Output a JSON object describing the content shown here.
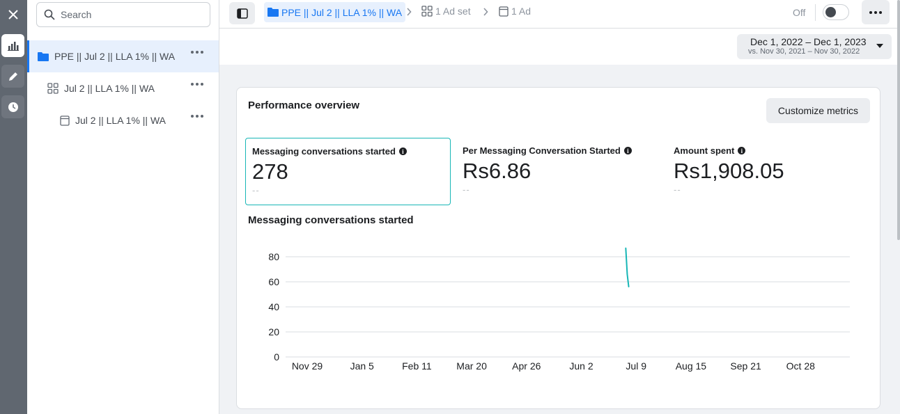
{
  "rail": {
    "close_icon": "close-icon",
    "performance_icon": "bar-chart-icon",
    "edit_icon": "pencil-icon",
    "history_icon": "clock-icon"
  },
  "sidebar": {
    "search_placeholder": "Search",
    "items": [
      {
        "label": "PPE || Jul 2 || LLA 1% || WA",
        "level": "campaign",
        "icon": "folder-icon"
      },
      {
        "label": "Jul 2 || LLA 1% || WA",
        "level": "ad-set",
        "icon": "grid-icon"
      },
      {
        "label": "Jul 2 || LLA 1% || WA",
        "level": "ad",
        "icon": "ad-icon"
      }
    ]
  },
  "topbar": {
    "breadcrumb": {
      "campaign": "PPE || Jul 2 || LLA 1% || WA",
      "adset": "1 Ad set",
      "ad": "1 Ad"
    },
    "toggle_label": "Off",
    "toggle_on": false
  },
  "date_range": {
    "main": "Dec 1, 2022 – Dec 1, 2023",
    "compare": "vs. Nov 30, 2021 – Nov 30, 2022"
  },
  "overview": {
    "title": "Performance overview",
    "customize_label": "Customize metrics",
    "metrics": [
      {
        "label": "Messaging conversations started",
        "value": "278",
        "sub": "--",
        "selected": true
      },
      {
        "label": "Per Messaging Conversation Started",
        "value": "Rs6.86",
        "sub": "--",
        "selected": false
      },
      {
        "label": "Amount spent",
        "value": "Rs1,908.05",
        "sub": "--",
        "selected": false
      }
    ],
    "chart_title": "Messaging conversations started"
  },
  "colors": {
    "accent": "#1877f2",
    "line": "#17b6b6",
    "rail": "#606770"
  },
  "chart_data": {
    "type": "line",
    "title": "",
    "xlabel": "",
    "ylabel": "",
    "ylim": [
      0,
      80
    ],
    "yticks": [
      0,
      20,
      40,
      60,
      80
    ],
    "xrange": [
      "2022-11-29",
      "2023-12-01"
    ],
    "xtick_dates": [
      "2022-11-29",
      "2023-01-05",
      "2023-02-11",
      "2023-03-20",
      "2023-04-26",
      "2023-06-02",
      "2023-07-09",
      "2023-08-15",
      "2023-09-21",
      "2023-10-28"
    ],
    "xtick_labels": [
      "Nov 29",
      "Jan 5",
      "Feb 11",
      "Mar 20",
      "Apr 26",
      "Jun 2",
      "Jul 9",
      "Aug 15",
      "Sep 21",
      "Oct 28"
    ],
    "grid": true,
    "series": [
      {
        "color": "#17b6b6",
        "points": [
          {
            "x": "2023-07-02",
            "y": 87
          },
          {
            "x": "2023-07-03",
            "y": 66
          },
          {
            "x": "2023-07-04",
            "y": 56
          }
        ]
      }
    ]
  }
}
